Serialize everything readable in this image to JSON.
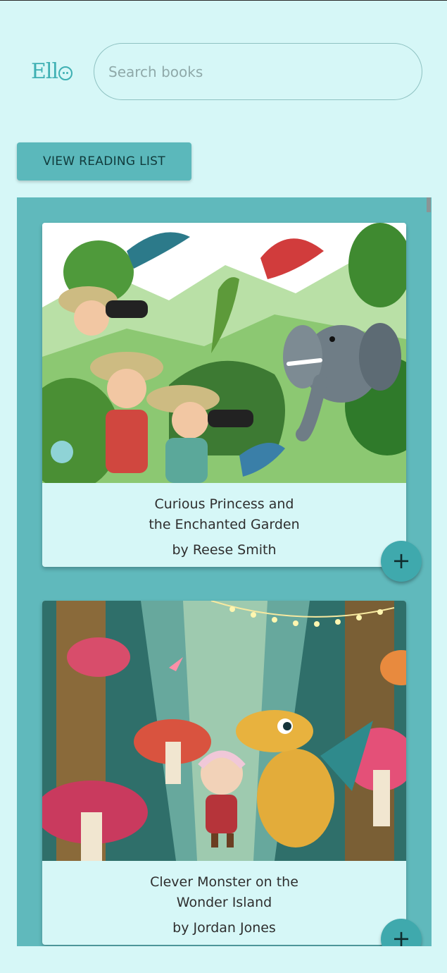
{
  "brand": {
    "logo_text": "Ell"
  },
  "search": {
    "placeholder": "Search books",
    "value": ""
  },
  "toolbar": {
    "reading_list_label": "VIEW READING LIST"
  },
  "books": [
    {
      "title_line1": "Curious Princess and",
      "title_line2": "the Enchanted Garden",
      "author": "by Reese Smith",
      "add_label": "+",
      "cover": "jungle-explorers-illustration"
    },
    {
      "title_line1": "Clever Monster on the",
      "title_line2": "Wonder Island",
      "author": "by Jordan Jones",
      "add_label": "+",
      "cover": "mushroom-forest-dragon-illustration"
    }
  ],
  "colors": {
    "background": "#d6f7f7",
    "accent": "#5bb8bb",
    "panel": "#60b9bc",
    "fab": "#3fa9ad"
  }
}
